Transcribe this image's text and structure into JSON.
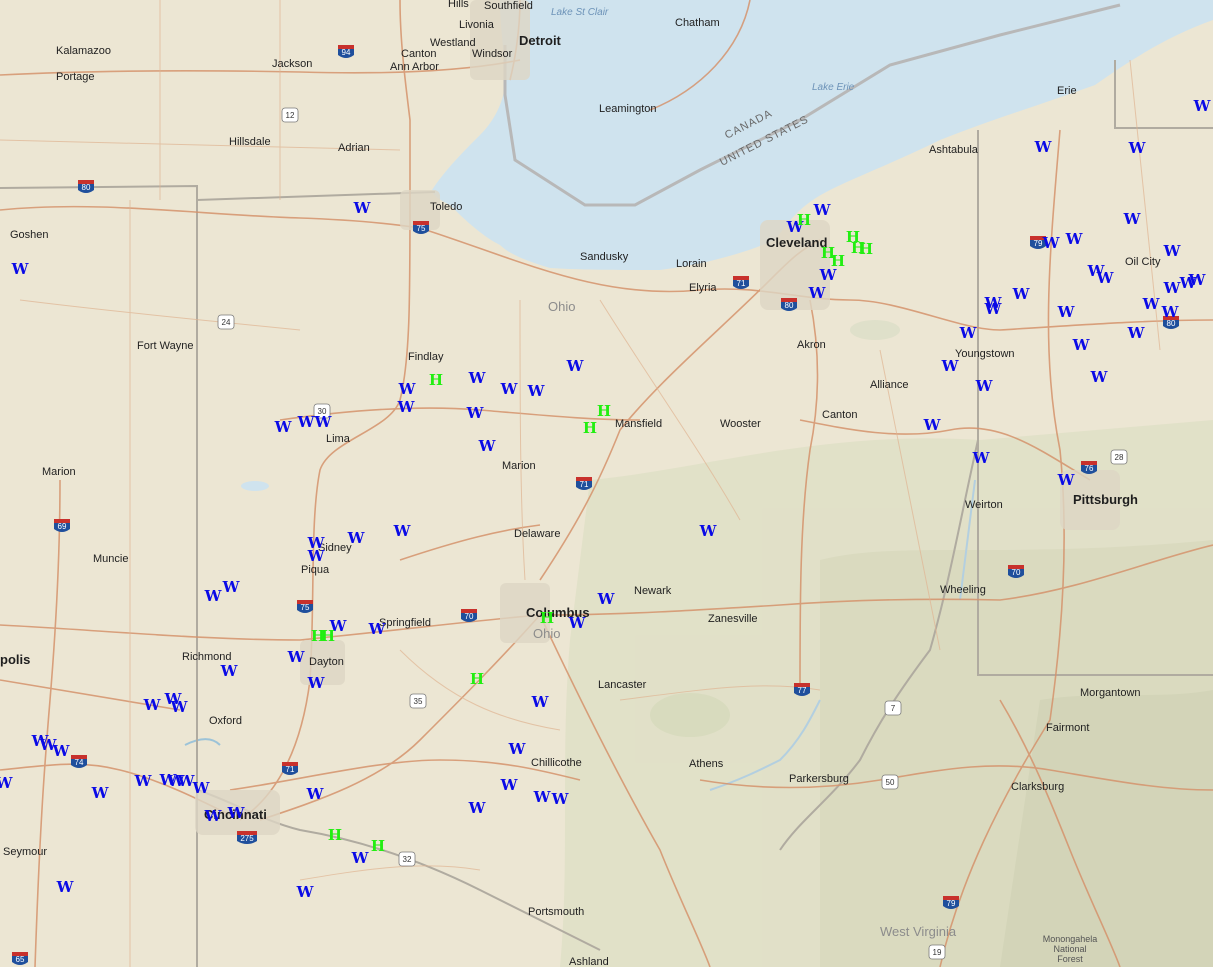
{
  "map": {
    "water_labels": [
      {
        "id": "lake-st-clair",
        "text": "Lake St Clair"
      },
      {
        "id": "lake-erie",
        "text": "Lake Erie"
      }
    ],
    "country_labels": [
      {
        "id": "canada",
        "text": "CANADA"
      },
      {
        "id": "united-states",
        "text": "UNITED STATES"
      }
    ],
    "state_labels": [
      {
        "id": "ohio-1",
        "text": "Ohio"
      },
      {
        "id": "ohio-2",
        "text": "Ohio"
      },
      {
        "id": "west-virginia",
        "text": "West Virginia"
      }
    ],
    "other_labels": [
      {
        "id": "monongahela",
        "lines": [
          "Monongahela",
          "National",
          "Forest"
        ]
      }
    ],
    "cities": [
      {
        "name": "Hills"
      },
      {
        "name": "Southfield"
      },
      {
        "name": "Livonia"
      },
      {
        "name": "Detroit",
        "big": true
      },
      {
        "name": "Westland"
      },
      {
        "name": "Windsor"
      },
      {
        "name": "Canton"
      },
      {
        "name": "Ann Arbor"
      },
      {
        "name": "Chatham"
      },
      {
        "name": "Kalamazoo"
      },
      {
        "name": "Portage"
      },
      {
        "name": "Jackson"
      },
      {
        "name": "Leamington"
      },
      {
        "name": "Hillsdale"
      },
      {
        "name": "Adrian"
      },
      {
        "name": "Erie"
      },
      {
        "name": "Ashtabula"
      },
      {
        "name": "Toledo"
      },
      {
        "name": "Goshen"
      },
      {
        "name": "Sandusky"
      },
      {
        "name": "Lorain"
      },
      {
        "name": "Cleveland",
        "big": true
      },
      {
        "name": "Elyria"
      },
      {
        "name": "Oil City"
      },
      {
        "name": "Fort Wayne"
      },
      {
        "name": "Findlay"
      },
      {
        "name": "Akron"
      },
      {
        "name": "Youngstown"
      },
      {
        "name": "Alliance"
      },
      {
        "name": "Lima"
      },
      {
        "name": "Canton"
      },
      {
        "name": "Mansfield"
      },
      {
        "name": "Wooster"
      },
      {
        "name": "Marion"
      },
      {
        "name": "Marion"
      },
      {
        "name": "Pittsburgh",
        "big": true
      },
      {
        "name": "Weirton"
      },
      {
        "name": "Delaware"
      },
      {
        "name": "Sidney"
      },
      {
        "name": "Muncie"
      },
      {
        "name": "Piqua"
      },
      {
        "name": "Newark"
      },
      {
        "name": "Columbus",
        "big": true
      },
      {
        "name": "Wheeling"
      },
      {
        "name": "Springfield"
      },
      {
        "name": "Zanesville"
      },
      {
        "name": "Richmond"
      },
      {
        "name": "Dayton"
      },
      {
        "name": "polis",
        "big": true
      },
      {
        "name": "Lancaster"
      },
      {
        "name": "Morgantown"
      },
      {
        "name": "Oxford"
      },
      {
        "name": "Fairmont"
      },
      {
        "name": "Chillicothe"
      },
      {
        "name": "Athens"
      },
      {
        "name": "Parkersburg"
      },
      {
        "name": "Clarksburg"
      },
      {
        "name": "Cincinnati",
        "big": true
      },
      {
        "name": "Seymour"
      },
      {
        "name": "Portsmouth"
      },
      {
        "name": "Ashland"
      }
    ],
    "highway_shields": [
      {
        "type": "interstate",
        "number": "94"
      },
      {
        "type": "us",
        "number": "12"
      },
      {
        "type": "interstate",
        "number": "80"
      },
      {
        "type": "interstate",
        "number": "75"
      },
      {
        "type": "interstate",
        "number": "71"
      },
      {
        "type": "interstate",
        "number": "80"
      },
      {
        "type": "us",
        "number": "24"
      },
      {
        "type": "us",
        "number": "30"
      },
      {
        "type": "interstate",
        "number": "79"
      },
      {
        "type": "interstate",
        "number": "80"
      },
      {
        "type": "interstate",
        "number": "76"
      },
      {
        "type": "us",
        "number": "28"
      },
      {
        "type": "interstate",
        "number": "71"
      },
      {
        "type": "interstate",
        "number": "69"
      },
      {
        "type": "interstate",
        "number": "70"
      },
      {
        "type": "interstate",
        "number": "75"
      },
      {
        "type": "interstate",
        "number": "70"
      },
      {
        "type": "interstate",
        "number": "77"
      },
      {
        "type": "us",
        "number": "35"
      },
      {
        "type": "interstate",
        "number": "74"
      },
      {
        "type": "interstate",
        "number": "71"
      },
      {
        "type": "us",
        "number": "7"
      },
      {
        "type": "us",
        "number": "50"
      },
      {
        "type": "interstate",
        "number": "275"
      },
      {
        "type": "us",
        "number": "32"
      },
      {
        "type": "interstate",
        "number": "79"
      },
      {
        "type": "interstate",
        "number": "65"
      },
      {
        "type": "us",
        "number": "19"
      }
    ],
    "markers": {
      "W": {
        "label": "W",
        "color": "#0a0ae6"
      },
      "H": {
        "label": "H",
        "color": "#22ee11"
      }
    }
  },
  "colors": {
    "land": "#ece6d3",
    "water": "#cfe3ee",
    "road": "#d5936c",
    "border": "#a8a8a8"
  }
}
